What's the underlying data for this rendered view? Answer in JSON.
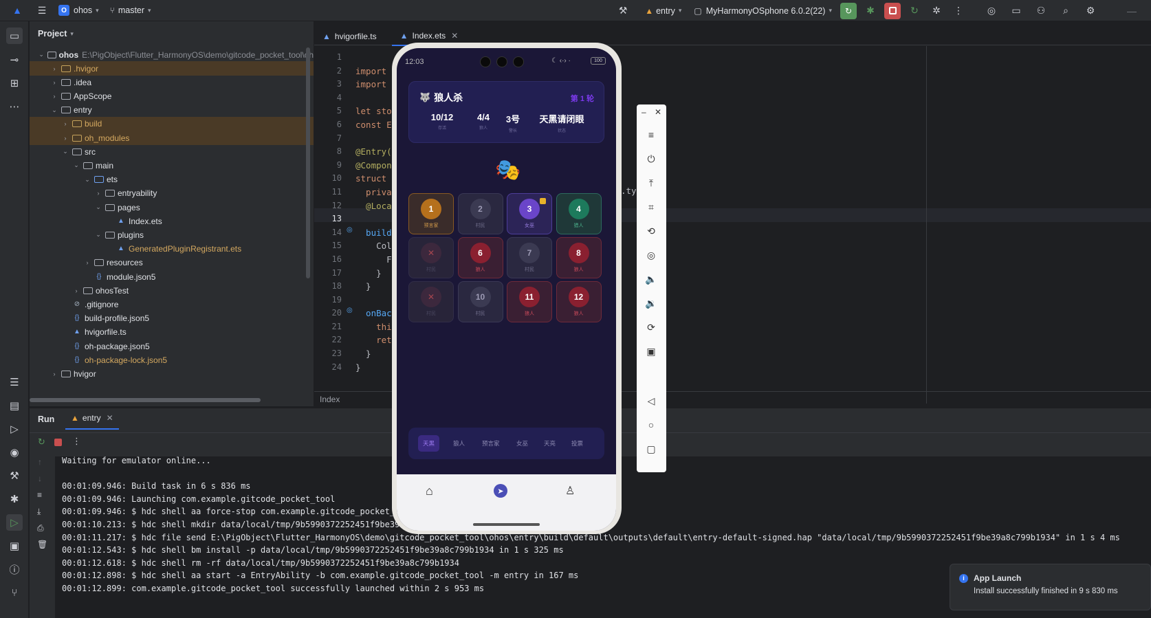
{
  "titlebar": {
    "project_badge": "O",
    "project_name": "ohos",
    "branch": "master",
    "run_config": "entry",
    "device": "MyHarmonyOSphone 6.0.2(22)"
  },
  "project_panel": {
    "title": "Project",
    "root_name": "ohos",
    "root_path": "E:\\PigObject\\Flutter_HarmonyOS\\demo\\gitcode_pocket_tool\\oh",
    "items": [
      {
        "label": ".hvigor",
        "type": "folder"
      },
      {
        "label": ".idea",
        "type": "folder"
      },
      {
        "label": "AppScope",
        "type": "folder"
      },
      {
        "label": "entry",
        "type": "folder"
      },
      {
        "label": "build",
        "type": "folder"
      },
      {
        "label": "oh_modules",
        "type": "folder"
      },
      {
        "label": "src",
        "type": "folder"
      },
      {
        "label": "main",
        "type": "folder"
      },
      {
        "label": "ets",
        "type": "folder"
      },
      {
        "label": "entryability",
        "type": "folder"
      },
      {
        "label": "pages",
        "type": "folder"
      },
      {
        "label": "Index.ets",
        "type": "file"
      },
      {
        "label": "plugins",
        "type": "folder"
      },
      {
        "label": "GeneratedPluginRegistrant.ets",
        "type": "file"
      },
      {
        "label": "resources",
        "type": "folder"
      },
      {
        "label": "module.json5",
        "type": "file"
      },
      {
        "label": "ohosTest",
        "type": "folder"
      },
      {
        "label": ".gitignore",
        "type": "file"
      },
      {
        "label": "build-profile.json5",
        "type": "file"
      },
      {
        "label": "hvigorfile.ts",
        "type": "file"
      },
      {
        "label": "oh-package.json5",
        "type": "file"
      },
      {
        "label": "oh-package-lock.json5",
        "type": "file"
      },
      {
        "label": "hvigor",
        "type": "folder"
      }
    ]
  },
  "editor": {
    "tabs": [
      {
        "label": "hvigorfile.ts"
      },
      {
        "label": "Index.ets"
      }
    ],
    "line_numbers": [
      "1",
      "2",
      "3",
      "4",
      "5",
      "6",
      "7",
      "8",
      "9",
      "10",
      "11",
      "12",
      "13",
      "14",
      "15",
      "16",
      "17",
      "18",
      "19",
      "20",
      "21",
      "22",
      "23",
      "24"
    ],
    "code_lines": [
      "",
      "import",
      "import",
      "",
      "let sto",
      "const E",
      "",
      "@Entry(",
      "@Compon",
      "struct",
      "  priva",
      "  @Loca",
      "",
      "  build",
      "    Col",
      "      F",
      "    }",
      "  }",
      "",
      "  onBac",
      "    thi",
      "    ret",
      "  }",
      "}"
    ],
    "code_tail_line11": ".ty(",
    "breadcrumb": "Index"
  },
  "run_panel": {
    "title": "Run",
    "tab_label": "entry",
    "lines": [
      "Waiting for emulator online...",
      "",
      "00:01:09.946: Build task in 6 s 836 ms",
      "00:01:09.946: Launching com.example.gitcode_pocket_tool",
      "00:01:09.946: $ hdc shell aa force-stop com.example.gitcode_pocket_",
      "00:01:10.213: $ hdc shell mkdir data/local/tmp/9b5990372252451f9be39",
      "00:01:11.217: $ hdc file send E:\\PigObject\\Flutter_HarmonyOS\\demo\\gitcode_pocket_tool\\ohos\\entry\\build\\default\\outputs\\default\\entry-default-signed.hap \"data/local/tmp/9b5990372252451f9be39a8c799b1934\" in 1 s 4 ms",
      "00:01:12.543: $ hdc shell bm install -p data/local/tmp/9b5990372252451f9be39a8c799b1934 in 1 s 325 ms",
      "00:01:12.618: $ hdc shell rm -rf data/local/tmp/9b5990372252451f9be39a8c799b1934",
      "00:01:12.898: $ hdc shell aa start -a EntryAbility -b com.example.gitcode_pocket_tool -m entry in 167 ms",
      "00:01:12.899: com.example.gitcode_pocket_tool successfully launched within 2 s 953 ms"
    ]
  },
  "toast": {
    "title": "App Launch",
    "message": "Install successfully finished in 9 s 830 ms"
  },
  "phone": {
    "status_time": "12:03",
    "battery": "100",
    "app_title": "狼人杀",
    "round": "第 1 轮",
    "stats": [
      {
        "value": "10/12",
        "label": "存活"
      },
      {
        "value": "4/4",
        "label": "狼人"
      },
      {
        "value": "3号",
        "label": "警长"
      },
      {
        "value": "天黑请闭眼",
        "label": "状态"
      }
    ],
    "emoji": "🎭",
    "players": [
      {
        "num": "1",
        "role": "预言家",
        "style": "seer"
      },
      {
        "num": "2",
        "role": "村民",
        "style": "villager"
      },
      {
        "num": "3",
        "role": "女巫",
        "style": "witch"
      },
      {
        "num": "4",
        "role": "猎人",
        "style": "hunter"
      },
      {
        "num": "✕",
        "role": "村民",
        "style": "dead"
      },
      {
        "num": "6",
        "role": "狼人",
        "style": "wolf"
      },
      {
        "num": "7",
        "role": "村民",
        "style": "villager"
      },
      {
        "num": "8",
        "role": "狼人",
        "style": "wolf"
      },
      {
        "num": "✕",
        "role": "村民",
        "style": "dead"
      },
      {
        "num": "10",
        "role": "村民",
        "style": "villager"
      },
      {
        "num": "11",
        "role": "狼人",
        "style": "wolf"
      },
      {
        "num": "12",
        "role": "狼人",
        "style": "wolf"
      }
    ],
    "phases": [
      "天黑",
      "狼人",
      "预言家",
      "女巫",
      "天亮",
      "投票"
    ],
    "active_phase": "天黑"
  },
  "colors": {
    "accent": "#3574f0",
    "run_green": "#57965c",
    "stop_red": "#c94f4f",
    "phone_bg": "#1b1737",
    "purple": "#7c3aed"
  }
}
